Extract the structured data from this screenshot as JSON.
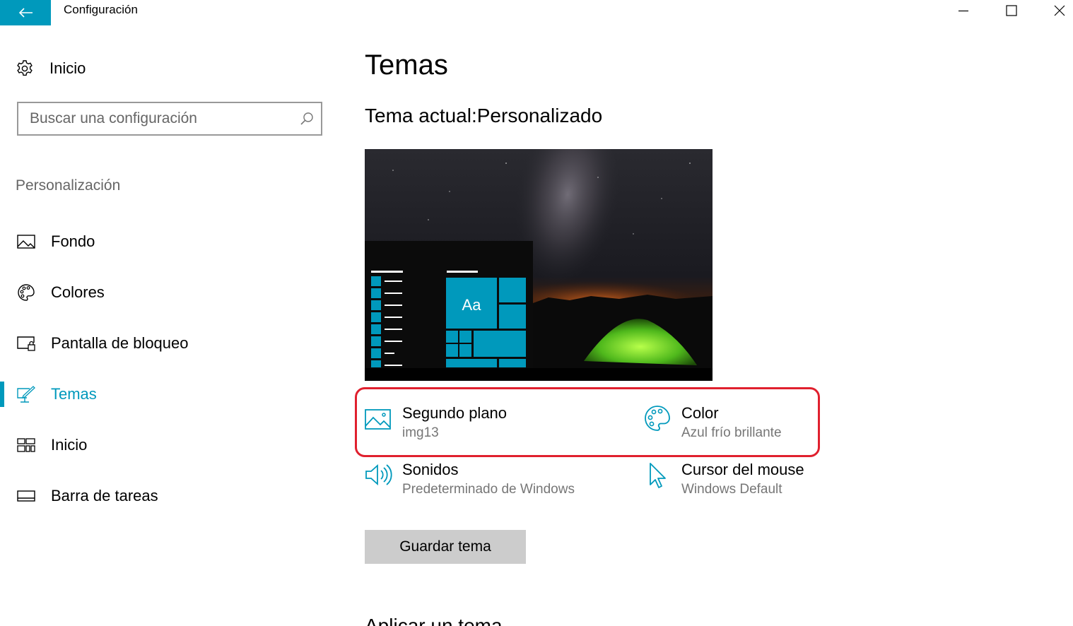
{
  "window": {
    "title": "Configuración",
    "accent_color": "#0099bc"
  },
  "sidebar": {
    "home_label": "Inicio",
    "search_placeholder": "Buscar una configuración",
    "section_label": "Personalización",
    "items": [
      {
        "label": "Fondo",
        "icon": "picture-icon",
        "active": false
      },
      {
        "label": "Colores",
        "icon": "palette-icon",
        "active": false
      },
      {
        "label": "Pantalla de bloqueo",
        "icon": "lock-screen-icon",
        "active": false
      },
      {
        "label": "Temas",
        "icon": "themes-icon",
        "active": true
      },
      {
        "label": "Inicio",
        "icon": "start-tiles-icon",
        "active": false
      },
      {
        "label": "Barra de tareas",
        "icon": "taskbar-icon",
        "active": false
      }
    ]
  },
  "main": {
    "title": "Temas",
    "current_theme_label": "Tema actual:",
    "current_theme_value": "Personalizado",
    "preview": {
      "tile_text": "Aa"
    },
    "options": [
      {
        "title": "Segundo plano",
        "value": "img13",
        "icon": "picture-icon"
      },
      {
        "title": "Color",
        "value": "Azul frío brillante",
        "icon": "palette-icon"
      },
      {
        "title": "Sonidos",
        "value": "Predeterminado de Windows",
        "icon": "speaker-icon"
      },
      {
        "title": "Cursor del mouse",
        "value": "Windows Default",
        "icon": "cursor-icon"
      }
    ],
    "save_button": "Guardar tema",
    "next_heading": "Aplicar un tema",
    "highlight_color": "#e0202e"
  }
}
